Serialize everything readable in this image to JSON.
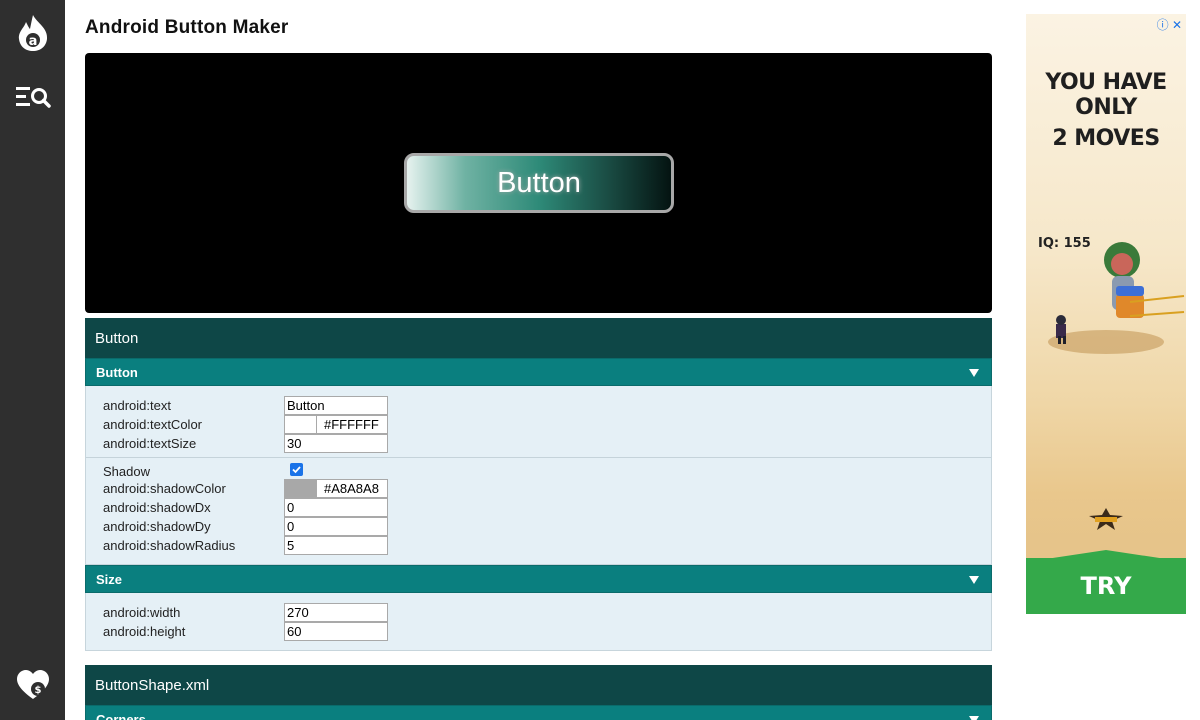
{
  "page": {
    "title": "Android Button Maker"
  },
  "preview": {
    "button_text": "Button"
  },
  "sections": {
    "button_section": "Button",
    "shape_section": "ButtonShape.xml"
  },
  "button_group": {
    "header": "Button",
    "text_label": "android:text",
    "text_value": "Button",
    "textColor_label": "android:textColor",
    "textColor_value": "#FFFFFF",
    "textSize_label": "android:textSize",
    "textSize_value": "30",
    "shadow_label": "Shadow",
    "shadow_enabled": true,
    "shadowColor_label": "android:shadowColor",
    "shadowColor_value": "#A8A8A8",
    "shadowDx_label": "android:shadowDx",
    "shadowDx_value": "0",
    "shadowDy_label": "android:shadowDy",
    "shadowDy_value": "0",
    "shadowRadius_label": "android:shadowRadius",
    "shadowRadius_value": "5"
  },
  "size_group": {
    "header": "Size",
    "width_label": "android:width",
    "width_value": "270",
    "height_label": "android:height",
    "height_value": "60"
  },
  "corners_group": {
    "header": "Corners"
  },
  "ad": {
    "line1": "YOU HAVE ONLY",
    "line2": "2 MOVES",
    "iq": "IQ: 155",
    "cta": "TRY"
  },
  "colors": {
    "sidebar": "#2f2f2f",
    "section_header": "#0e4747",
    "sub_header": "#0a7f7f",
    "panel_bg": "#e5f0f6",
    "text_color_swatch": "#FFFFFF",
    "shadow_color_swatch": "#A8A8A8"
  },
  "icons": [
    "logo-icon",
    "search-menu-icon",
    "donate-heart-icon",
    "expand-triangle-icon",
    "ad-info-icon",
    "ad-close-icon"
  ]
}
